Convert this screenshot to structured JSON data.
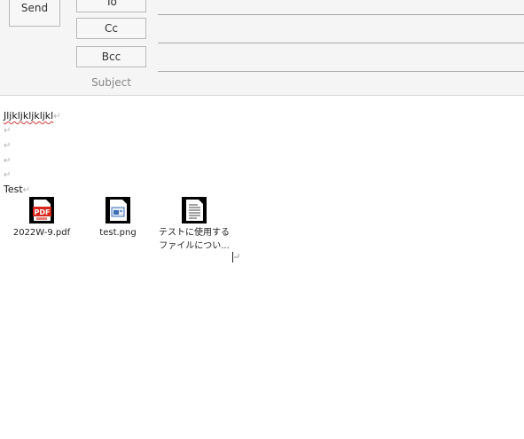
{
  "header": {
    "send_label": "Send",
    "to_label": "To",
    "cc_label": "Cc",
    "bcc_label": "Bcc",
    "subject_label": "Subject"
  },
  "body": {
    "line1": "Jljkljkljkljkl",
    "pilcrow": "↵",
    "test_line": "Test"
  },
  "attachments": [
    {
      "name": "2022W-9.pdf",
      "icon": "pdf-file-icon",
      "badge": "PDF"
    },
    {
      "name": "test.png",
      "icon": "image-file-icon"
    },
    {
      "name_line1": "テストに使用する",
      "name_line2": "ファイルについ...",
      "icon": "text-document-icon"
    }
  ],
  "colors": {
    "pdf_red": "#d9261c",
    "spellcheck": "#d43a3a",
    "image_blue": "#3d6fb3"
  }
}
